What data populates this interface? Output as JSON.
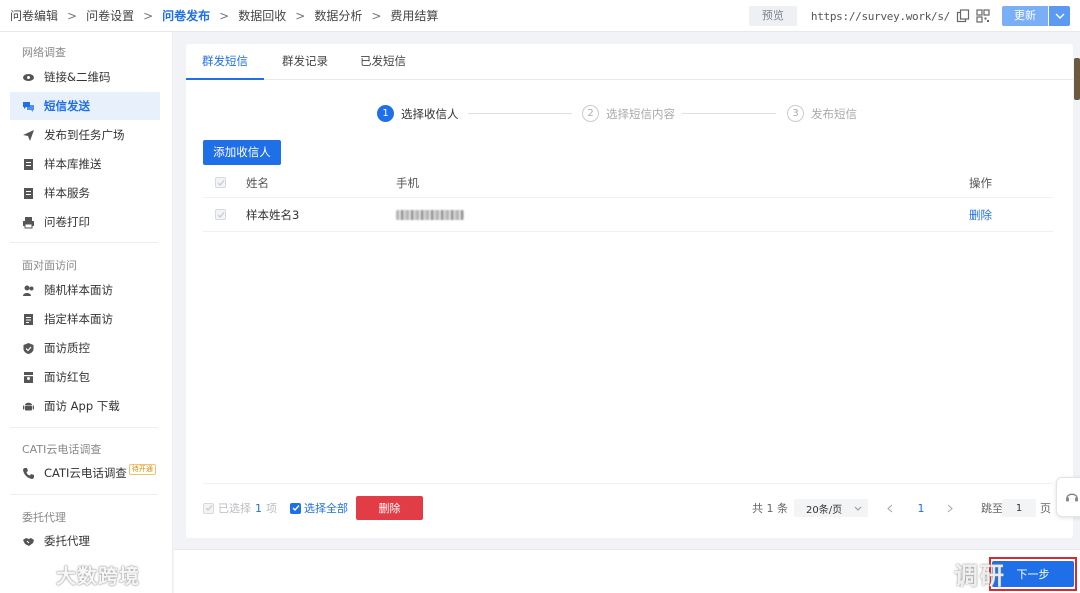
{
  "breadcrumbs": [
    {
      "label": "问卷编辑"
    },
    {
      "label": "问卷设置"
    },
    {
      "label": "问卷发布"
    },
    {
      "label": "数据回收"
    },
    {
      "label": "数据分析"
    },
    {
      "label": "费用结算"
    }
  ],
  "breadcrumb_separator": ">",
  "topbar": {
    "preview_label": "预览",
    "url": "https://survey.work/s/",
    "update_label": "更新"
  },
  "sidebar": {
    "group1_title": "网络调查",
    "group1_items": [
      {
        "label": "链接&二维码",
        "icon": "eye-icon"
      },
      {
        "label": "短信发送",
        "icon": "sms-icon"
      },
      {
        "label": "发布到任务广场",
        "icon": "send-icon"
      },
      {
        "label": "样本库推送",
        "icon": "list-icon"
      },
      {
        "label": "样本服务",
        "icon": "list-icon"
      },
      {
        "label": "问卷打印",
        "icon": "printer-icon"
      }
    ],
    "group2_title": "面对面访问",
    "group2_items": [
      {
        "label": "随机样本面访",
        "icon": "people-icon"
      },
      {
        "label": "指定样本面访",
        "icon": "document-icon"
      },
      {
        "label": "面访质控",
        "icon": "shield-icon"
      },
      {
        "label": "面访红包",
        "icon": "gift-icon"
      },
      {
        "label": "面访 App 下载",
        "icon": "android-icon"
      }
    ],
    "group3_title": "CATI云电话调查",
    "group3_items": [
      {
        "label": "CATI云电话调查",
        "icon": "phone-icon",
        "badge": "待开通"
      }
    ],
    "group4_title": "委托代理",
    "group4_items": [
      {
        "label": "委托代理",
        "icon": "handshake-icon"
      }
    ]
  },
  "tabs": [
    {
      "label": "群发短信"
    },
    {
      "label": "群发记录"
    },
    {
      "label": "已发短信"
    }
  ],
  "steps": [
    {
      "num": "1",
      "label": "选择收信人"
    },
    {
      "num": "2",
      "label": "选择短信内容"
    },
    {
      "num": "3",
      "label": "发布短信"
    }
  ],
  "add_recipient_label": "添加收信人",
  "table": {
    "headers": {
      "name": "姓名",
      "phone": "手机",
      "action": "操作"
    },
    "rows": [
      {
        "name": "样本姓名3",
        "action": "删除"
      }
    ]
  },
  "footer": {
    "selected_prefix": "已选择",
    "selected_count": "1",
    "selected_suffix": "项",
    "select_all_label": "选择全部",
    "delete_label": "删除",
    "total_text": "共 1 条",
    "page_size": "20条/页",
    "current_page": "1",
    "goto_label": "跳至",
    "goto_value": "1",
    "page_unit": "页"
  },
  "next_label": "下一步",
  "watermark_left": "大数跨境",
  "watermark_right": "调研"
}
